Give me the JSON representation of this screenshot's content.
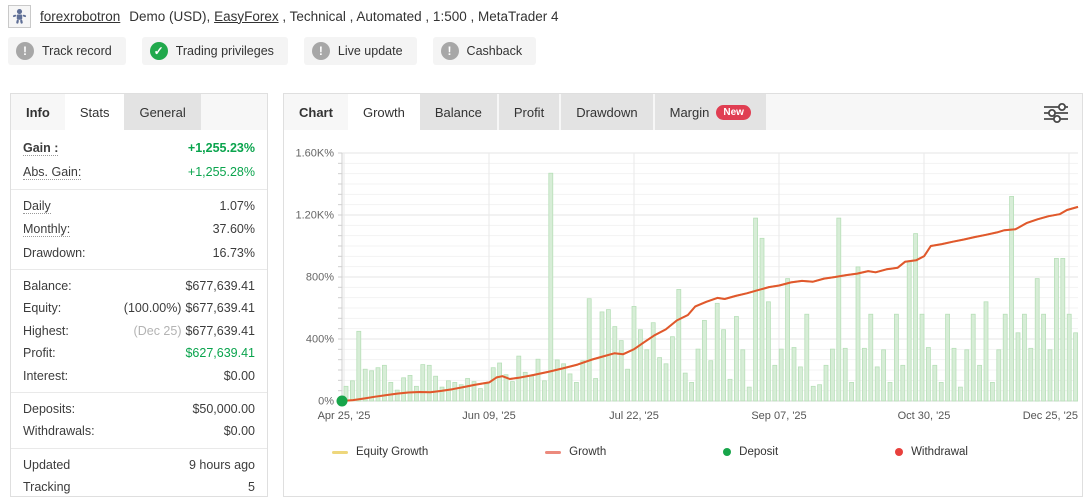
{
  "header": {
    "account_name": "forexrobotron",
    "subtitle_prefix": "Demo (USD), ",
    "subtitle_link": "EasyForex",
    "subtitle_suffix": " , Technical , Automated , 1:500 , MetaTrader 4"
  },
  "badges": [
    {
      "label": "Track record",
      "status": "warning"
    },
    {
      "label": "Trading privileges",
      "status": "ok"
    },
    {
      "label": "Live update",
      "status": "warning"
    },
    {
      "label": "Cashback",
      "status": "warning"
    }
  ],
  "sidebar": {
    "tabs": [
      {
        "label": "Info",
        "state": "plain"
      },
      {
        "label": "Stats",
        "state": "active"
      },
      {
        "label": "General",
        "state": "inactive"
      }
    ],
    "rows": [
      {
        "label": "Gain :",
        "value": "+1,255.23%",
        "label_dotted": true,
        "bold": true,
        "value_color": "green"
      },
      {
        "label": "Abs. Gain:",
        "value": "+1,255.28%",
        "label_dotted": true,
        "value_color": "green"
      },
      {
        "divider": true
      },
      {
        "label": "Daily",
        "value": "1.07%",
        "label_dotted": true
      },
      {
        "label": "Monthly:",
        "value": "37.60%",
        "label_dotted": true
      },
      {
        "label": "Drawdown:",
        "value": "16.73%"
      },
      {
        "divider": true
      },
      {
        "label": "Balance:",
        "value": "$677,639.41"
      },
      {
        "label": "Equity:",
        "value": "$677,639.41",
        "prefix": "(100.00%)"
      },
      {
        "label": "Highest:",
        "value": "$677,639.41",
        "prefix": "(Dec 25)",
        "prefix_muted": true
      },
      {
        "label": "Profit:",
        "value": "$627,639.41",
        "value_color": "green"
      },
      {
        "label": "Interest:",
        "value": "$0.00"
      },
      {
        "divider": true
      },
      {
        "label": "Deposits:",
        "value": "$50,000.00"
      },
      {
        "label": "Withdrawals:",
        "value": "$0.00"
      },
      {
        "divider": true
      },
      {
        "label": "Updated",
        "value": "9 hours ago"
      },
      {
        "label": "Tracking",
        "value": "5"
      }
    ]
  },
  "chart_panel": {
    "tabs": [
      {
        "label": "Chart",
        "state": "plain"
      },
      {
        "label": "Growth",
        "state": "active"
      },
      {
        "label": "Balance",
        "state": "inactive"
      },
      {
        "label": "Profit",
        "state": "inactive"
      },
      {
        "label": "Drawdown",
        "state": "inactive"
      },
      {
        "label": "Margin",
        "state": "inactive",
        "badge": "New"
      }
    ],
    "settings_icon": "filter-sliders-icon"
  },
  "chart_data": {
    "type": "line",
    "title": "Growth",
    "xlabel": "",
    "ylabel": "",
    "ylim": [
      0,
      1600
    ],
    "grid": "on",
    "legend_position": "bottom",
    "y_ticks": [
      {
        "value": 0,
        "label": "0%"
      },
      {
        "value": 400,
        "label": "400%"
      },
      {
        "value": 800,
        "label": "800%"
      },
      {
        "value": 1200,
        "label": "1.20K%"
      },
      {
        "value": 1600,
        "label": "1.60K%"
      }
    ],
    "x_ticks": [
      "Apr 25, '25",
      "Jun 09, '25",
      "Jul 22, '25",
      "Sep 07, '25",
      "Oct 30, '25",
      "Dec 25, '25"
    ],
    "series": [
      {
        "name": "Equity Growth",
        "type": "line",
        "color": "#eed77c",
        "same_as": "Growth"
      },
      {
        "name": "Growth",
        "type": "line",
        "color": "#e0572e",
        "points": [
          [
            0,
            0
          ],
          [
            0.015,
            6
          ],
          [
            0.03,
            16
          ],
          [
            0.045,
            28
          ],
          [
            0.06,
            38
          ],
          [
            0.075,
            48
          ],
          [
            0.09,
            55
          ],
          [
            0.105,
            58
          ],
          [
            0.12,
            57
          ],
          [
            0.135,
            65
          ],
          [
            0.15,
            76
          ],
          [
            0.165,
            90
          ],
          [
            0.18,
            104
          ],
          [
            0.2,
            120
          ],
          [
            0.21,
            152
          ],
          [
            0.218,
            160
          ],
          [
            0.228,
            142
          ],
          [
            0.24,
            150
          ],
          [
            0.26,
            168
          ],
          [
            0.28,
            188
          ],
          [
            0.3,
            210
          ],
          [
            0.32,
            235
          ],
          [
            0.34,
            268
          ],
          [
            0.355,
            288
          ],
          [
            0.37,
            308
          ],
          [
            0.382,
            302
          ],
          [
            0.397,
            335
          ],
          [
            0.41,
            378
          ],
          [
            0.425,
            425
          ],
          [
            0.44,
            462
          ],
          [
            0.455,
            520
          ],
          [
            0.47,
            555
          ],
          [
            0.48,
            610
          ],
          [
            0.495,
            640
          ],
          [
            0.51,
            665
          ],
          [
            0.52,
            658
          ],
          [
            0.535,
            678
          ],
          [
            0.55,
            695
          ],
          [
            0.565,
            715
          ],
          [
            0.58,
            735
          ],
          [
            0.594,
            745
          ],
          [
            0.61,
            765
          ],
          [
            0.625,
            775
          ],
          [
            0.64,
            770
          ],
          [
            0.655,
            790
          ],
          [
            0.67,
            800
          ],
          [
            0.685,
            812
          ],
          [
            0.7,
            822
          ],
          [
            0.715,
            838
          ],
          [
            0.725,
            830
          ],
          [
            0.74,
            850
          ],
          [
            0.755,
            860
          ],
          [
            0.765,
            898
          ],
          [
            0.78,
            908
          ],
          [
            0.791,
            935
          ],
          [
            0.8,
            1000
          ],
          [
            0.815,
            1012
          ],
          [
            0.83,
            1028
          ],
          [
            0.845,
            1042
          ],
          [
            0.86,
            1058
          ],
          [
            0.875,
            1072
          ],
          [
            0.89,
            1088
          ],
          [
            0.9,
            1102
          ],
          [
            0.915,
            1108
          ],
          [
            0.93,
            1148
          ],
          [
            0.945,
            1172
          ],
          [
            0.96,
            1192
          ],
          [
            0.975,
            1205
          ],
          [
            0.985,
            1232
          ],
          [
            1,
            1252
          ]
        ]
      },
      {
        "name": "Periodic gain bars",
        "type": "bar",
        "color": "#d7edd7",
        "stroke": "#b5dfb6",
        "values": [
          95,
          130,
          450,
          205,
          195,
          215,
          230,
          120,
          70,
          150,
          165,
          95,
          235,
          230,
          160,
          90,
          130,
          120,
          105,
          145,
          125,
          80,
          110,
          215,
          245,
          170,
          125,
          290,
          185,
          160,
          270,
          130,
          1470,
          265,
          240,
          175,
          120,
          260,
          660,
          145,
          575,
          590,
          480,
          390,
          205,
          610,
          460,
          330,
          505,
          280,
          240,
          415,
          720,
          180,
          120,
          335,
          520,
          260,
          630,
          460,
          140,
          545,
          330,
          90,
          1180,
          1050,
          640,
          230,
          335,
          790,
          345,
          220,
          560,
          95,
          105,
          230,
          335,
          1180,
          340,
          120,
          865,
          340,
          560,
          220,
          330,
          120,
          560,
          230,
          900,
          1080,
          560,
          345,
          230,
          120,
          560,
          340,
          90,
          330,
          560,
          230,
          640,
          120,
          330,
          560,
          1320,
          440,
          560,
          340,
          790,
          560,
          330,
          920,
          920,
          560,
          440
        ]
      }
    ],
    "markers": [
      {
        "name": "Deposit",
        "x": 0,
        "value": 0,
        "color": "#18a54a"
      }
    ],
    "legend": [
      {
        "label": "Equity Growth",
        "swatch": "line",
        "color": "#eed77c"
      },
      {
        "label": "Growth",
        "swatch": "line",
        "color": "#ec8a7d"
      },
      {
        "label": "Deposit",
        "swatch": "dot",
        "color": "#18a54a"
      },
      {
        "label": "Withdrawal",
        "swatch": "dot",
        "color": "#e8403c"
      }
    ]
  },
  "colors": {
    "positive_green": "#0aa44d",
    "growth_line": "#e0572e",
    "bar_fill": "#d7edd7",
    "new_badge": "#e03e52",
    "ok_badge": "#21a94c",
    "warning_badge": "#a7a7a7"
  }
}
